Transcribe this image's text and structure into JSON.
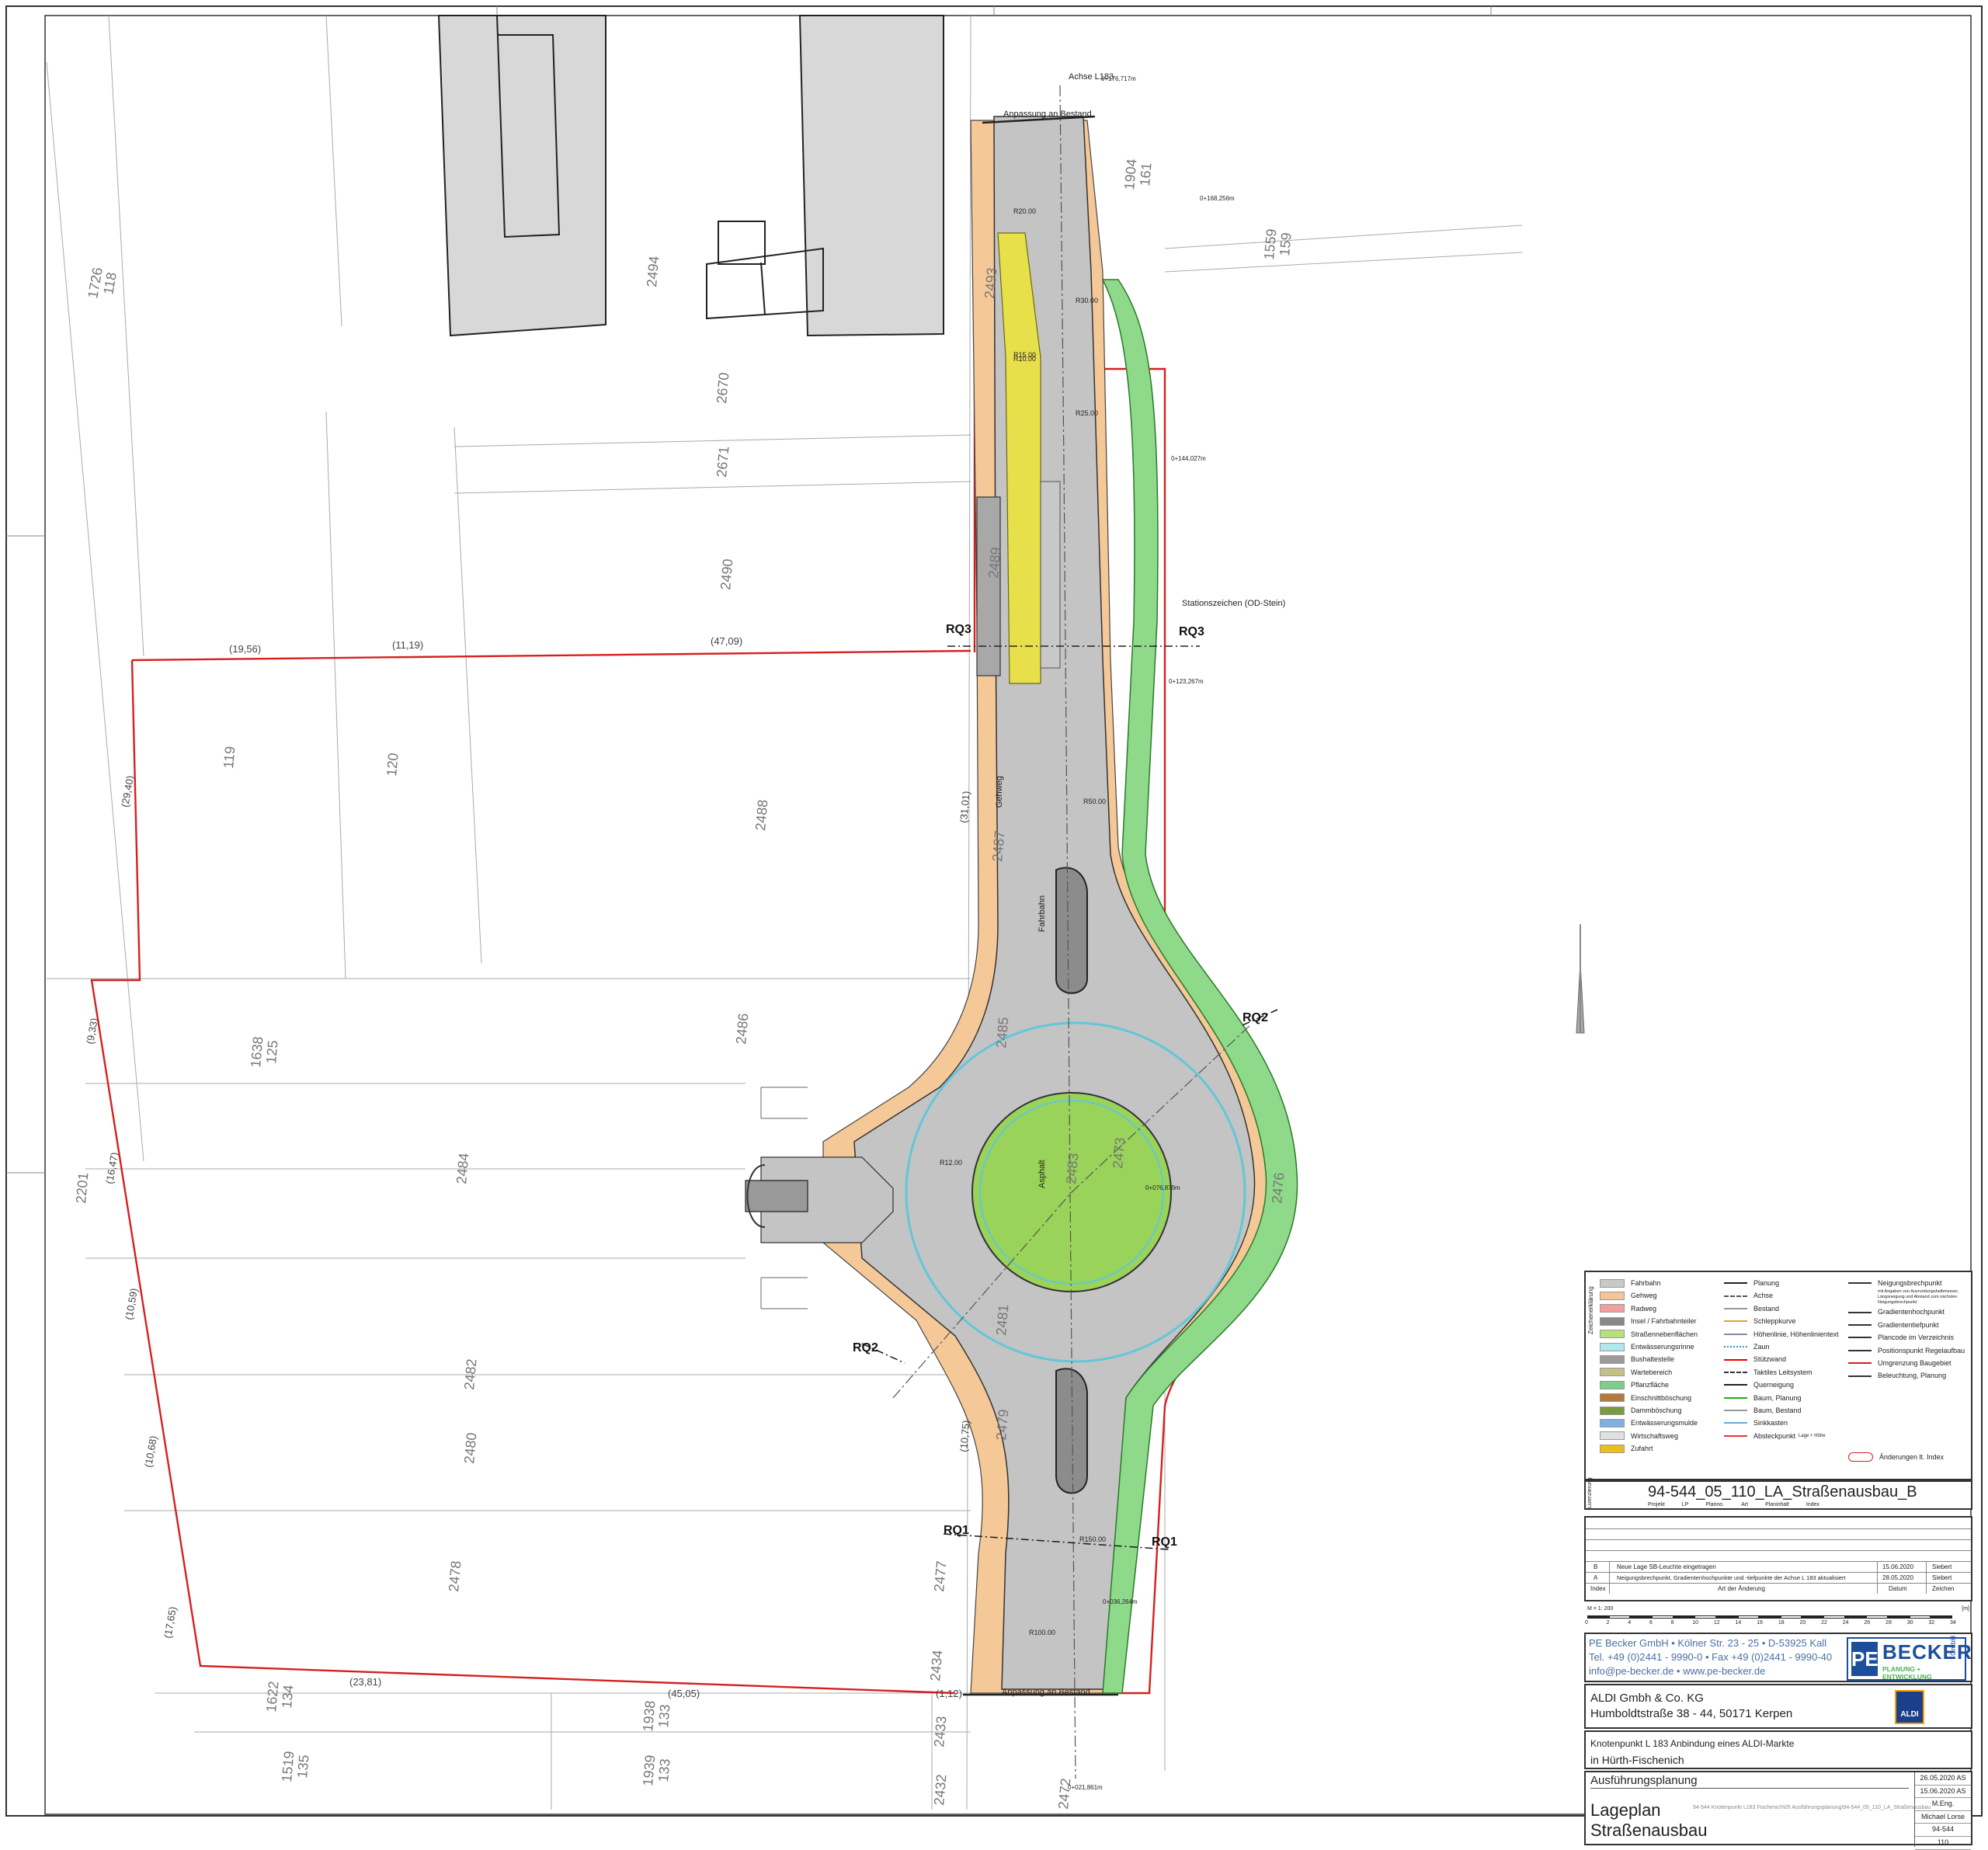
{
  "plot": {
    "parcels": [
      "1726",
      "118",
      "2494",
      "2493",
      "2670",
      "2671",
      "1904",
      "161",
      "1559",
      "159",
      "2490",
      "2489",
      "2488",
      "119",
      "120",
      "2487",
      "2486",
      "1638",
      "125",
      "2485",
      "2484",
      "2483",
      "2473",
      "2476",
      "2482",
      "2481",
      "2480",
      "2479",
      "2478",
      "2477",
      "2434",
      "2433",
      "2432",
      "1622",
      "134",
      "1938",
      "133",
      "1939",
      "133",
      "1519",
      "135",
      "2201",
      "2472"
    ],
    "boundary_dims": [
      "(19,56)",
      "(11,19)",
      "(47,09)",
      "(29,40)",
      "(31,01)",
      "(9,33)",
      "(16,47)",
      "(10,59)",
      "(10,68)",
      "(17,65)",
      "(23,81)",
      "(45,05)",
      "(10,75)",
      "(1,12)"
    ],
    "sections": [
      "RQ3",
      "RQ3",
      "RQ2",
      "RQ2",
      "RQ1",
      "RQ1"
    ],
    "callouts": [
      "Anpassung an Bestand",
      "Anpassung an Bestand",
      "Stationszeichen (OD-Stein)",
      "Achse L183",
      "Asphalt",
      "Gehweg",
      "Fahrbahn"
    ],
    "radii": [
      "R20.00",
      "R15.00",
      "R10.00",
      "R25.00",
      "R30.00",
      "R50.00",
      "R150.00",
      "R100.00",
      "R12.00"
    ],
    "stations": [
      "0+176,717m",
      "0+168,256m",
      "0+144,027m",
      "0+123,267m",
      "0+076,879m",
      "0+036,264m",
      "0+021,861m"
    ]
  },
  "legend": {
    "vertical_label": "Zeichenerklärung",
    "col1": [
      {
        "label": "Fahrbahn",
        "color": "#c8c8c8"
      },
      {
        "label": "Gehweg",
        "color": "#f6c596"
      },
      {
        "label": "Radweg",
        "color": "#f0a0a0"
      },
      {
        "label": "Insel / Fahrbahnteiler",
        "color": "#888888"
      },
      {
        "label": "Straßennebenflächen",
        "color": "#b8e07a"
      },
      {
        "label": "Entwässerungsrinne",
        "color": "#b0e6ee"
      },
      {
        "label": "Bushaltestelle",
        "color": "#9a9a9a"
      },
      {
        "label": "Wartebereich",
        "color": "#c4c08a"
      },
      {
        "label": "Pflanzfläche",
        "color": "#7ccf88"
      },
      {
        "label": "Einschnittböschung",
        "color": "#b07a40"
      },
      {
        "label": "Dammböschung",
        "color": "#7a9a40"
      },
      {
        "label": "Entwässerungsmulde",
        "color": "#80b0e0"
      },
      {
        "label": "Wirtschaftsweg",
        "color": "#e0e0e0"
      },
      {
        "label": "Zufahrt",
        "color": "#e8c21a"
      }
    ],
    "col2": [
      "Planung",
      "Achse",
      "Bestand",
      "Schleppkurve",
      "Höhenlinie, Höhenlinientext",
      "Zaun",
      "Stützwand",
      "Taktiles Leitsystem",
      "Querneigung",
      "Baum, Planung",
      "Baum, Bestand",
      "Sinkkasten",
      "Absteckpunkt"
    ],
    "col2_sub": "Lage + Höhe",
    "col3": [
      "Neigungsbrechpunkt",
      "Gradientenhochpunkt",
      "Gradiententiefpunkt",
      "Plancode im Verzeichnis",
      "Positionspunkt Regelaufbau",
      "Umgrenzung Baugebiet",
      "Beleuchtung, Planung"
    ],
    "col3_sub": "mit Angaben von Ausrundungshalbmesser, Längsneigung und Abstand zum nächsten Neigungsbrechpunkt",
    "revision_mark": "Änderungen lt. Index"
  },
  "file": {
    "vertical_label": "Lizenzierung",
    "name": "94-544_05_110_LA_Straßenausbau_B",
    "sub": [
      "Projekt",
      "LP",
      "Planno.",
      "Art",
      "Planinhalt",
      "Index"
    ]
  },
  "revisions": {
    "rows": [
      {
        "index": "B",
        "desc": "Neue Lage SB-Leuchte eingetragen",
        "date": "15.06.2020",
        "sign": "Siebert"
      },
      {
        "index": "A",
        "desc": "Neigungsbrechpunkt, Gradientenhochpunkte und -tiefpunkte der Achse L 183 aktualisiert",
        "date": "28.05.2020",
        "sign": "Siebert"
      }
    ],
    "headers": [
      "Index",
      "Art der Änderung",
      "Datum",
      "Zeichen"
    ]
  },
  "scale": {
    "label": "M = 1: 200",
    "unit": "[m]",
    "ticks": [
      "0",
      "2",
      "4",
      "6",
      "8",
      "10",
      "12",
      "14",
      "16",
      "18",
      "20",
      "22",
      "24",
      "26",
      "28",
      "30",
      "32",
      "34"
    ]
  },
  "firm": {
    "line1": "PE Becker GmbH • Kölner Str. 23 - 25 • D-53925 Kall",
    "line2": "Tel. +49 (0)2441 - 9990-0 • Fax +49 (0)2441 - 9990-40",
    "line3": "info@pe-becker.de • www.pe-becker.de",
    "logo_main": "BECKER",
    "logo_gmbh": "GmbH",
    "logo_sub": "PLANUNG + ENTWICKLUNG",
    "logo_colors": {
      "blue": "#1b4f9c",
      "green": "#4caf50"
    }
  },
  "client": {
    "name": "ALDI Gmbh & Co. KG",
    "address": "Humboldtstraße 38 - 44, 50171 Kerpen",
    "logo": "ALDI"
  },
  "project": {
    "line1": "Knotenpunkt L 183 Anbindung eines ALDI-Markte",
    "line2": "in Hürth-Fischenich"
  },
  "plan": {
    "phase": "Ausführungsplanung",
    "title1": "Lageplan",
    "title2": "Straßenausbau"
  },
  "status": [
    "26.05.2020 AS",
    "15.06.2020 AS",
    "M.Eng.",
    "Michael Lorse",
    "94-544",
    "110"
  ],
  "footer": "94-544 Knotenpunkt L183 Fischenich\\05 Ausführungsplanung\\94-544_05_110_LA_Straßenausbau"
}
